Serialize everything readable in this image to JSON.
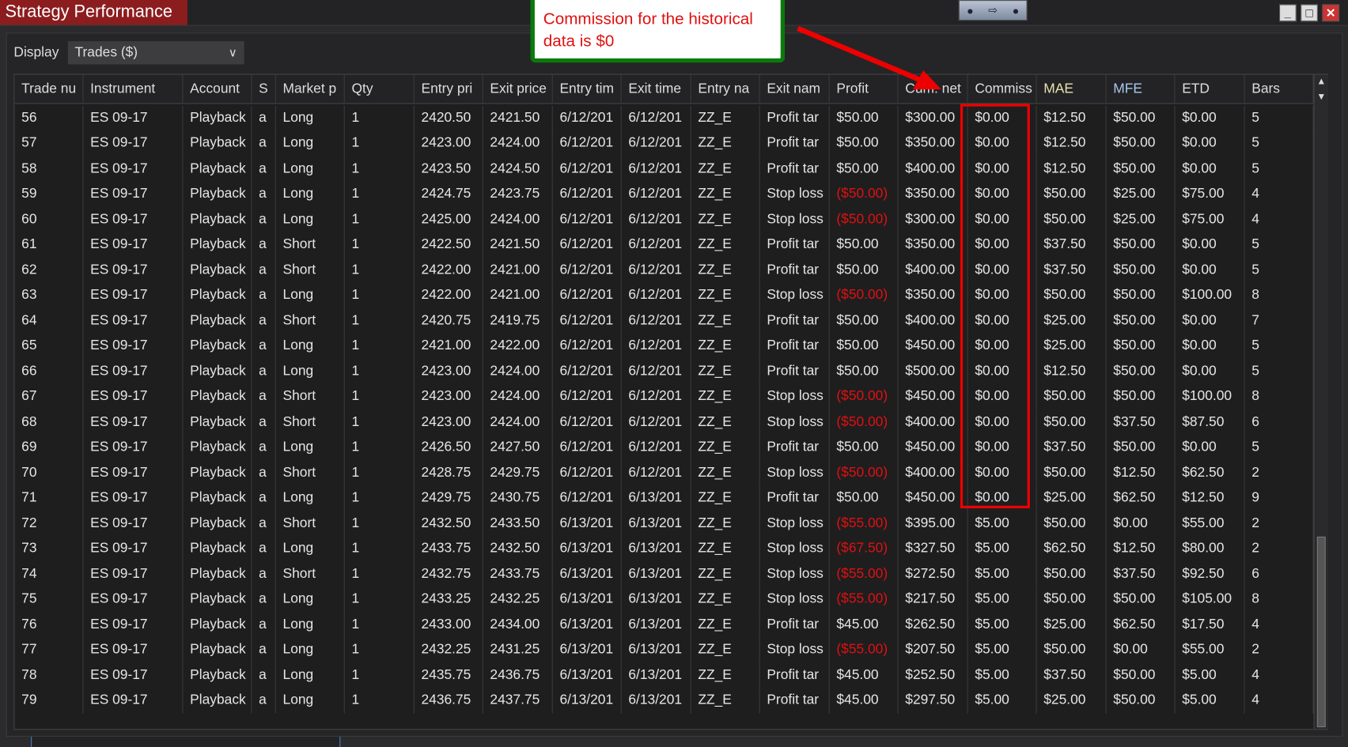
{
  "window": {
    "title": "Strategy Performance",
    "tool_icons": [
      "record-icon",
      "export-icon",
      "circle-icon"
    ],
    "controls": [
      "minimize",
      "maximize",
      "close"
    ]
  },
  "display": {
    "label": "Display",
    "selected": "Trades ($)"
  },
  "annotation": {
    "text": "Commission for the historical data is $0",
    "box_color": "#0a7a0a",
    "arrow_color": "#e00000"
  },
  "table": {
    "columns": [
      "Trade nu",
      "Instrument",
      "Account",
      "S",
      "Market p",
      "Qty",
      "Entry pri",
      "Exit price",
      "Entry tim",
      "Exit time",
      "Entry na",
      "Exit nam",
      "Profit",
      "Cum. net",
      "Commiss",
      "MAE",
      "MFE",
      "ETD",
      "Bars"
    ],
    "rows": [
      [
        "56",
        "ES 09-17",
        "Playback",
        "a",
        "Long",
        "1",
        "2420.50",
        "2421.50",
        "6/12/201",
        "6/12/201",
        "ZZ_E",
        "Profit tar",
        "$50.00",
        "$300.00",
        "$0.00",
        "$12.50",
        "$50.00",
        "$0.00",
        "5"
      ],
      [
        "57",
        "ES 09-17",
        "Playback",
        "a",
        "Long",
        "1",
        "2423.00",
        "2424.00",
        "6/12/201",
        "6/12/201",
        "ZZ_E",
        "Profit tar",
        "$50.00",
        "$350.00",
        "$0.00",
        "$12.50",
        "$50.00",
        "$0.00",
        "5"
      ],
      [
        "58",
        "ES 09-17",
        "Playback",
        "a",
        "Long",
        "1",
        "2423.50",
        "2424.50",
        "6/12/201",
        "6/12/201",
        "ZZ_E",
        "Profit tar",
        "$50.00",
        "$400.00",
        "$0.00",
        "$12.50",
        "$50.00",
        "$0.00",
        "5"
      ],
      [
        "59",
        "ES 09-17",
        "Playback",
        "a",
        "Long",
        "1",
        "2424.75",
        "2423.75",
        "6/12/201",
        "6/12/201",
        "ZZ_E",
        "Stop loss",
        "($50.00)",
        "$350.00",
        "$0.00",
        "$50.00",
        "$25.00",
        "$75.00",
        "4"
      ],
      [
        "60",
        "ES 09-17",
        "Playback",
        "a",
        "Long",
        "1",
        "2425.00",
        "2424.00",
        "6/12/201",
        "6/12/201",
        "ZZ_E",
        "Stop loss",
        "($50.00)",
        "$300.00",
        "$0.00",
        "$50.00",
        "$25.00",
        "$75.00",
        "4"
      ],
      [
        "61",
        "ES 09-17",
        "Playback",
        "a",
        "Short",
        "1",
        "2422.50",
        "2421.50",
        "6/12/201",
        "6/12/201",
        "ZZ_E",
        "Profit tar",
        "$50.00",
        "$350.00",
        "$0.00",
        "$37.50",
        "$50.00",
        "$0.00",
        "5"
      ],
      [
        "62",
        "ES 09-17",
        "Playback",
        "a",
        "Short",
        "1",
        "2422.00",
        "2421.00",
        "6/12/201",
        "6/12/201",
        "ZZ_E",
        "Profit tar",
        "$50.00",
        "$400.00",
        "$0.00",
        "$37.50",
        "$50.00",
        "$0.00",
        "5"
      ],
      [
        "63",
        "ES 09-17",
        "Playback",
        "a",
        "Long",
        "1",
        "2422.00",
        "2421.00",
        "6/12/201",
        "6/12/201",
        "ZZ_E",
        "Stop loss",
        "($50.00)",
        "$350.00",
        "$0.00",
        "$50.00",
        "$50.00",
        "$100.00",
        "8"
      ],
      [
        "64",
        "ES 09-17",
        "Playback",
        "a",
        "Short",
        "1",
        "2420.75",
        "2419.75",
        "6/12/201",
        "6/12/201",
        "ZZ_E",
        "Profit tar",
        "$50.00",
        "$400.00",
        "$0.00",
        "$25.00",
        "$50.00",
        "$0.00",
        "7"
      ],
      [
        "65",
        "ES 09-17",
        "Playback",
        "a",
        "Long",
        "1",
        "2421.00",
        "2422.00",
        "6/12/201",
        "6/12/201",
        "ZZ_E",
        "Profit tar",
        "$50.00",
        "$450.00",
        "$0.00",
        "$25.00",
        "$50.00",
        "$0.00",
        "5"
      ],
      [
        "66",
        "ES 09-17",
        "Playback",
        "a",
        "Long",
        "1",
        "2423.00",
        "2424.00",
        "6/12/201",
        "6/12/201",
        "ZZ_E",
        "Profit tar",
        "$50.00",
        "$500.00",
        "$0.00",
        "$12.50",
        "$50.00",
        "$0.00",
        "5"
      ],
      [
        "67",
        "ES 09-17",
        "Playback",
        "a",
        "Short",
        "1",
        "2423.00",
        "2424.00",
        "6/12/201",
        "6/12/201",
        "ZZ_E",
        "Stop loss",
        "($50.00)",
        "$450.00",
        "$0.00",
        "$50.00",
        "$50.00",
        "$100.00",
        "8"
      ],
      [
        "68",
        "ES 09-17",
        "Playback",
        "a",
        "Short",
        "1",
        "2423.00",
        "2424.00",
        "6/12/201",
        "6/12/201",
        "ZZ_E",
        "Stop loss",
        "($50.00)",
        "$400.00",
        "$0.00",
        "$50.00",
        "$37.50",
        "$87.50",
        "6"
      ],
      [
        "69",
        "ES 09-17",
        "Playback",
        "a",
        "Long",
        "1",
        "2426.50",
        "2427.50",
        "6/12/201",
        "6/12/201",
        "ZZ_E",
        "Profit tar",
        "$50.00",
        "$450.00",
        "$0.00",
        "$37.50",
        "$50.00",
        "$0.00",
        "5"
      ],
      [
        "70",
        "ES 09-17",
        "Playback",
        "a",
        "Short",
        "1",
        "2428.75",
        "2429.75",
        "6/12/201",
        "6/12/201",
        "ZZ_E",
        "Stop loss",
        "($50.00)",
        "$400.00",
        "$0.00",
        "$50.00",
        "$12.50",
        "$62.50",
        "2"
      ],
      [
        "71",
        "ES 09-17",
        "Playback",
        "a",
        "Long",
        "1",
        "2429.75",
        "2430.75",
        "6/12/201",
        "6/13/201",
        "ZZ_E",
        "Profit tar",
        "$50.00",
        "$450.00",
        "$0.00",
        "$25.00",
        "$62.50",
        "$12.50",
        "9"
      ],
      [
        "72",
        "ES 09-17",
        "Playback",
        "a",
        "Short",
        "1",
        "2432.50",
        "2433.50",
        "6/13/201",
        "6/13/201",
        "ZZ_E",
        "Stop loss",
        "($55.00)",
        "$395.00",
        "$5.00",
        "$50.00",
        "$0.00",
        "$55.00",
        "2"
      ],
      [
        "73",
        "ES 09-17",
        "Playback",
        "a",
        "Long",
        "1",
        "2433.75",
        "2432.50",
        "6/13/201",
        "6/13/201",
        "ZZ_E",
        "Stop loss",
        "($67.50)",
        "$327.50",
        "$5.00",
        "$62.50",
        "$12.50",
        "$80.00",
        "2"
      ],
      [
        "74",
        "ES 09-17",
        "Playback",
        "a",
        "Short",
        "1",
        "2432.75",
        "2433.75",
        "6/13/201",
        "6/13/201",
        "ZZ_E",
        "Stop loss",
        "($55.00)",
        "$272.50",
        "$5.00",
        "$50.00",
        "$37.50",
        "$92.50",
        "6"
      ],
      [
        "75",
        "ES 09-17",
        "Playback",
        "a",
        "Long",
        "1",
        "2433.25",
        "2432.25",
        "6/13/201",
        "6/13/201",
        "ZZ_E",
        "Stop loss",
        "($55.00)",
        "$217.50",
        "$5.00",
        "$50.00",
        "$50.00",
        "$105.00",
        "8"
      ],
      [
        "76",
        "ES 09-17",
        "Playback",
        "a",
        "Long",
        "1",
        "2433.00",
        "2434.00",
        "6/13/201",
        "6/13/201",
        "ZZ_E",
        "Profit tar",
        "$45.00",
        "$262.50",
        "$5.00",
        "$25.00",
        "$62.50",
        "$17.50",
        "4"
      ],
      [
        "77",
        "ES 09-17",
        "Playback",
        "a",
        "Long",
        "1",
        "2432.25",
        "2431.25",
        "6/13/201",
        "6/13/201",
        "ZZ_E",
        "Stop loss",
        "($55.00)",
        "$207.50",
        "$5.00",
        "$50.00",
        "$0.00",
        "$55.00",
        "2"
      ],
      [
        "78",
        "ES 09-17",
        "Playback",
        "a",
        "Long",
        "1",
        "2435.75",
        "2436.75",
        "6/13/201",
        "6/13/201",
        "ZZ_E",
        "Profit tar",
        "$45.00",
        "$252.50",
        "$5.00",
        "$37.50",
        "$50.00",
        "$5.00",
        "4"
      ],
      [
        "79",
        "ES 09-17",
        "Playback",
        "a",
        "Long",
        "1",
        "2436.75",
        "2437.75",
        "6/13/201",
        "6/13/201",
        "ZZ_E",
        "Profit tar",
        "$45.00",
        "$297.50",
        "$5.00",
        "$25.00",
        "$50.00",
        "$5.00",
        "4"
      ]
    ]
  },
  "colors": {
    "title_bg": "#8c1d1f",
    "negative": "#e01010",
    "highlight_box": "#e00000"
  }
}
